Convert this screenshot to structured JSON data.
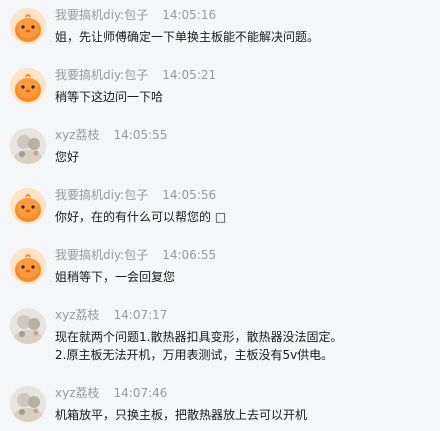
{
  "messages": [
    {
      "sender": "我要搞机diy:包子",
      "time": "14:05:16",
      "avatar": "chick-avatar",
      "lines": [
        "姐，先让师傅确定一下单换主板能不能解决问题。"
      ]
    },
    {
      "sender": "我要搞机diy:包子",
      "time": "14:05:21",
      "avatar": "chick-avatar",
      "lines": [
        "稍等下这边问一下哈"
      ]
    },
    {
      "sender": "xyz荔枝",
      "time": "14:05:55",
      "avatar": "customer-avatar",
      "lines": [
        "您好"
      ]
    },
    {
      "sender": "我要搞机diy:包子",
      "time": "14:05:56",
      "avatar": "chick-avatar",
      "lines": [
        "你好，在的有什么可以帮您的 □"
      ]
    },
    {
      "sender": "我要搞机diy:包子",
      "time": "14:06:55",
      "avatar": "chick-avatar",
      "lines": [
        "姐稍等下，一会回复您"
      ]
    },
    {
      "sender": "xyz荔枝",
      "time": "14:07:17",
      "avatar": "customer-avatar",
      "lines": [
        "现在就两个问题1.散热器扣具变形，散热器没法固定。",
        "2.原主板无法开机，万用表测试，主板没有5v供电。"
      ]
    },
    {
      "sender": "xyz荔枝",
      "time": "14:07:46",
      "avatar": "customer-avatar",
      "lines": [
        "机箱放平，只换主板，把散热器放上去可以开机"
      ]
    }
  ]
}
